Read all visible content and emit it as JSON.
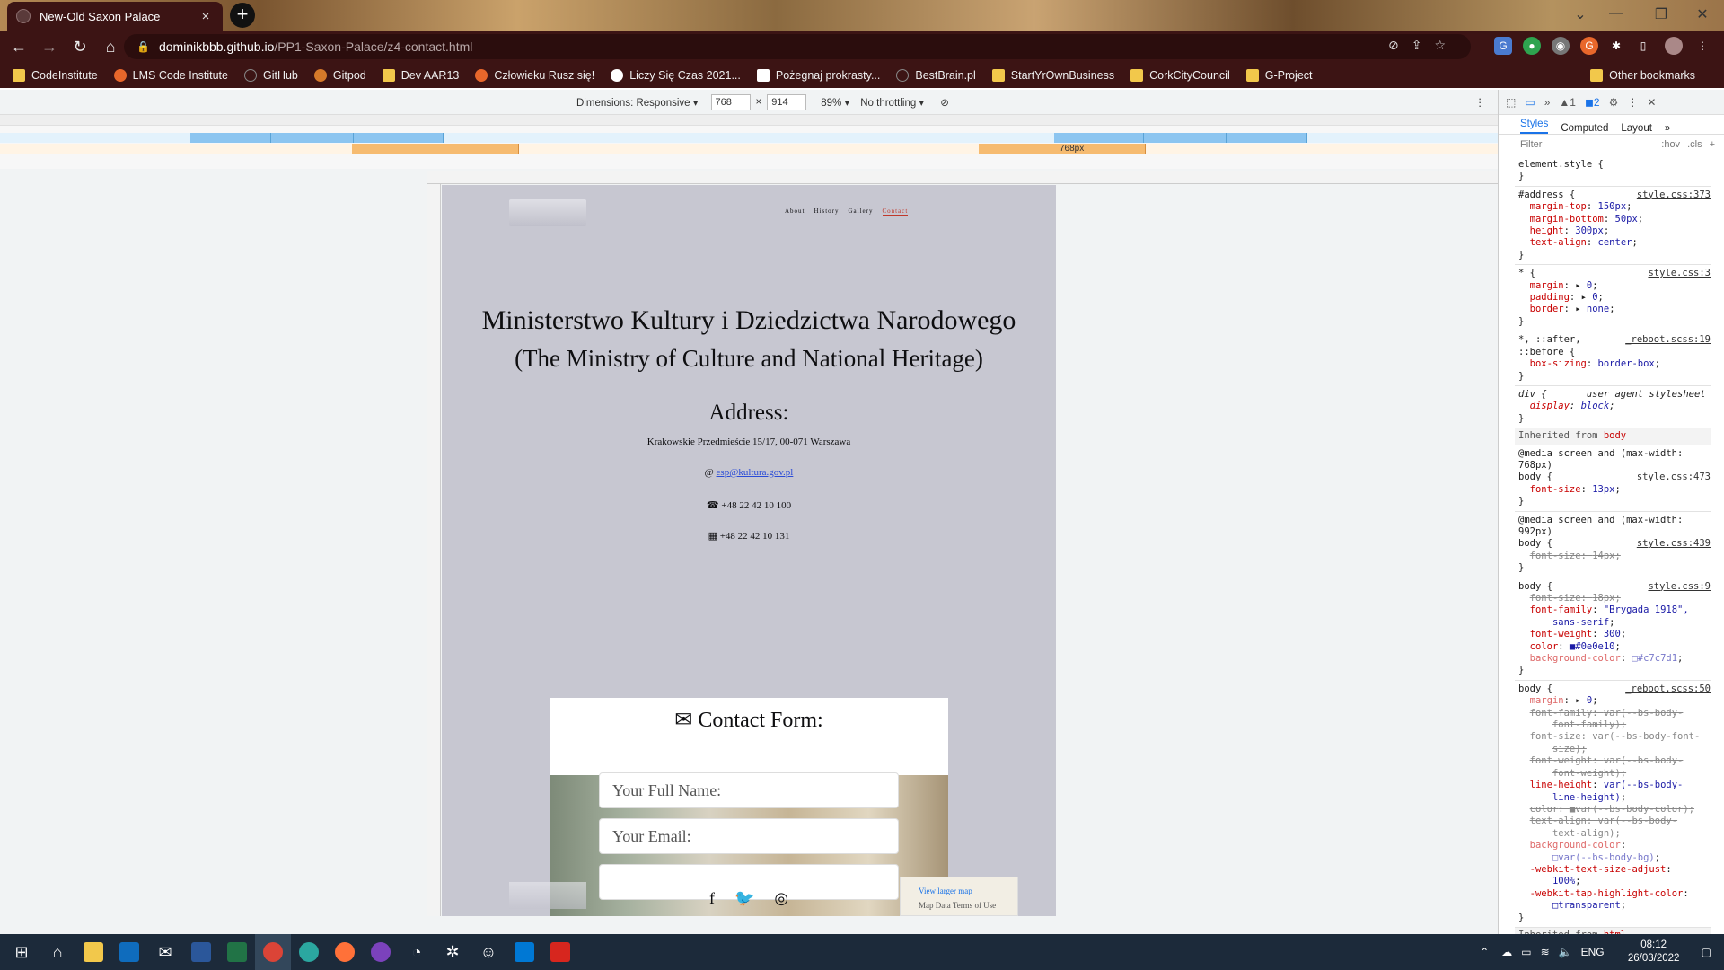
{
  "browser": {
    "tab_title": "New-Old Saxon Palace",
    "tab_close": "×",
    "new_tab": "+",
    "url_host": "dominikbbb.github.io",
    "url_path": "/PP1-Saxon-Palace/z4-contact.html",
    "bookmarks": [
      "CodeInstitute",
      "LMS Code Institute",
      "GitHub",
      "Gitpod",
      "Dev AAR13",
      "Człowieku Rusz się!",
      "Liczy Się Czas 2021...",
      "Pożegnaj prokrasty...",
      "BestBrain.pl",
      "StartYrOwnBusiness",
      "CorkCityCouncil",
      "G-Project"
    ],
    "other_bookmarks": "Other bookmarks"
  },
  "device_toolbar": {
    "dimensions_label": "Dimensions: Responsive ▾",
    "width": "768",
    "height": "914",
    "zoom": "89% ▾",
    "throttling": "No throttling ▾",
    "media_label": "768px"
  },
  "page": {
    "nav": [
      "About",
      "History",
      "Gallery",
      "Contact"
    ],
    "heading": "Ministerstwo Kultury i Dziedzictwa Narodowego",
    "subheading": "(The Ministry of Culture and National Heritage)",
    "address_title": "Address:",
    "address": "Krakowskie Przedmieście 15/17, 00-071 Warszawa",
    "email": "esp@kultura.gov.pl",
    "phone": "+48 22 42 10 100",
    "fax": "+48 22 42 10 131",
    "form_title": "Contact Form:",
    "name_placeholder": "Your Full Name:",
    "email_placeholder": "Your Email:",
    "map_link": "View larger map",
    "map_footer": "Map Data   Terms of Use"
  },
  "devtools": {
    "tabs": [
      "Styles",
      "Computed",
      "Layout"
    ],
    "filter": "Filter",
    "hov": ":hov",
    "cls": ".cls",
    "warnings": "1",
    "issues": "2",
    "inherited_from": "Inherited from",
    "inherited_body": "body",
    "inherited_html": "html"
  },
  "taskbar": {
    "lang": "ENG",
    "time": "08:12",
    "date": "26/03/2022"
  }
}
